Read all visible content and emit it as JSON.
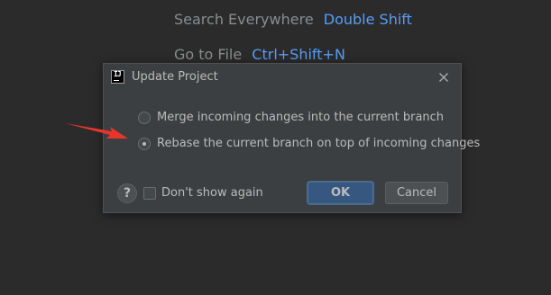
{
  "background_hints": [
    {
      "label": "Search Everywhere",
      "shortcut": "Double Shift"
    },
    {
      "label": "Go to File",
      "shortcut": "Ctrl+Shift+N"
    }
  ],
  "dialog": {
    "title": "Update Project",
    "icon": "intellij-app-icon",
    "options": [
      {
        "label": "Merge incoming changes into the current branch",
        "selected": false
      },
      {
        "label": "Rebase the current branch on top of incoming changes",
        "selected": true
      }
    ],
    "help_label": "?",
    "dont_show_label": "Don't show again",
    "dont_show_checked": false,
    "ok_label": "OK",
    "cancel_label": "Cancel"
  },
  "annotation": {
    "arrow_color": "#e8352b",
    "points_to": "Rebase option"
  },
  "colors": {
    "background": "#2b2b2b",
    "dialog": "#3c3f41",
    "accent_blue": "#589df6",
    "ok_button": "#365880"
  }
}
